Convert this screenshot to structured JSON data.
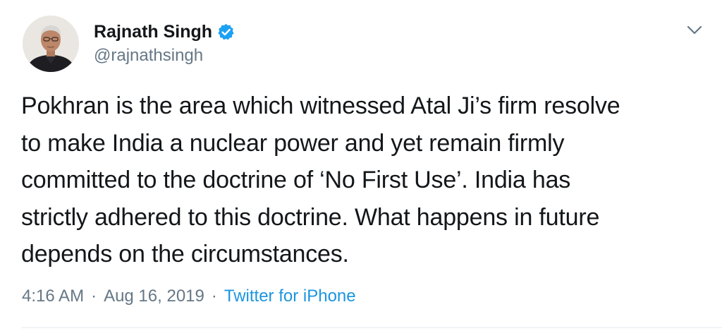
{
  "tweet": {
    "author_name": "Rajnath Singh",
    "handle": "@rajnathsingh",
    "verified": true,
    "text": "Pokhran is the area which witnessed Atal Ji’s firm resolve\nto make India a nuclear power and yet remain firmly\ncommitted to the doctrine of ‘No First Use’. India has\nstrictly adhered to this doctrine. What happens in future\ndepends on the circumstances.",
    "time": "4:16 AM",
    "separator": "·",
    "date": "Aug 16, 2019",
    "source": "Twitter for iPhone"
  },
  "icons": {
    "verified": "verified-badge-icon",
    "menu": "chevron-down-icon"
  },
  "colors": {
    "text": "#14171a",
    "secondary": "#657786",
    "link": "#1b95e0",
    "verified_blue": "#1da1f2",
    "divider": "#e6ecf0"
  }
}
